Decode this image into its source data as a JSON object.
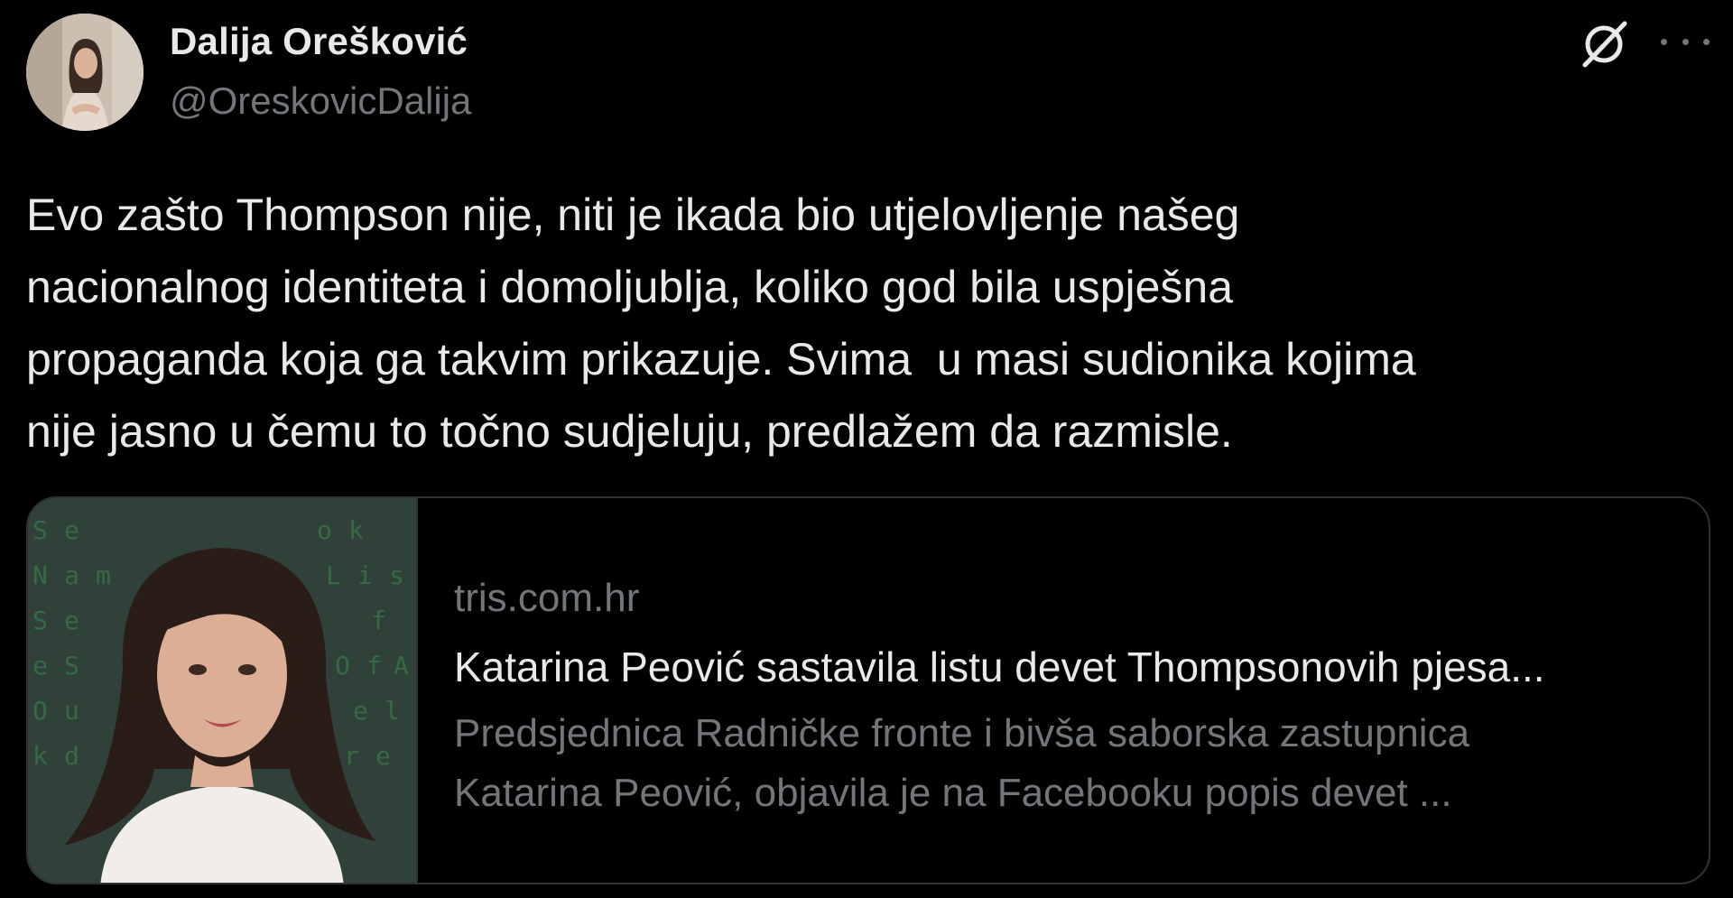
{
  "author": {
    "display_name": "Dalija Orešković",
    "handle": "@OreskovicDalija"
  },
  "tweet": {
    "text": "Evo zašto Thompson nije, niti je ikada bio utjelovljenje našeg\nnacionalnog identiteta i domoljublja, koliko god bila uspješna\npropaganda koja ga takvim prikazuje. Svima  u masi sudionika kojima\nnije jasno u čemu to točno sudjeluju, predlažem da razmisle."
  },
  "card": {
    "domain": "tris.com.hr",
    "title": "Katarina Peović sastavila listu devet Thompsonovih pjesa...",
    "description": "Predsjednica Radničke fronte i bivša saborska zastupnica\nKatarina Peović, objavila je na Facebooku popis devet ..."
  },
  "icons": {
    "grok": "grok-icon",
    "more": "more-options-icon"
  },
  "colors": {
    "background": "#000000",
    "primary_text": "#e7e9ea",
    "secondary_text": "#71767b",
    "border": "#2f3336"
  }
}
